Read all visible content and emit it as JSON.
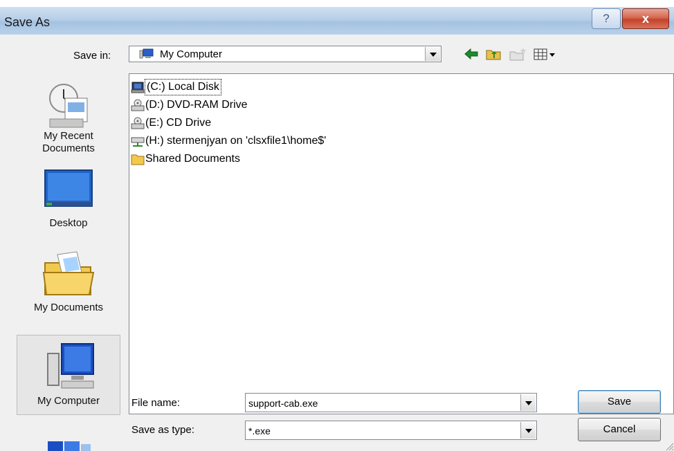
{
  "window": {
    "title": "Save As",
    "help_label": "?",
    "close_label": "x"
  },
  "save_in": {
    "label": "Save in:",
    "value": "My Computer"
  },
  "places": [
    {
      "label": "My Recent Documents"
    },
    {
      "label": "Desktop"
    },
    {
      "label": "My Documents"
    },
    {
      "label": "My Computer"
    }
  ],
  "files": [
    {
      "name": "(C:) Local Disk"
    },
    {
      "name": "(D:) DVD-RAM Drive"
    },
    {
      "name": "(E:) CD Drive"
    },
    {
      "name": "(H:) stermenjyan on 'clsxfile1\\home$'"
    },
    {
      "name": "Shared Documents"
    }
  ],
  "file_name": {
    "label": "File name:",
    "value": "support-cab.exe"
  },
  "save_as_type": {
    "label": "Save as type:",
    "value": "*.exe"
  },
  "buttons": {
    "save": "Save",
    "cancel": "Cancel"
  }
}
